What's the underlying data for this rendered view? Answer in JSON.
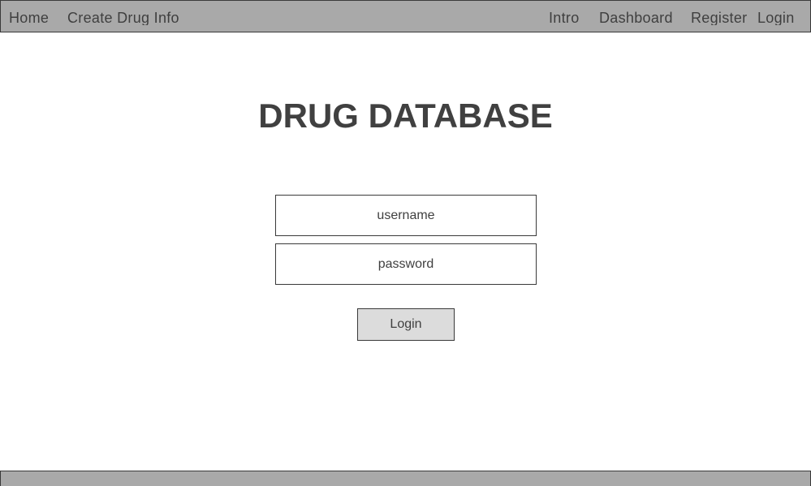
{
  "navbar": {
    "left_links": [
      {
        "label": "Home"
      },
      {
        "label": "Create Drug Info"
      }
    ],
    "right_links": [
      {
        "label": "Intro"
      },
      {
        "label": "Dashboard"
      },
      {
        "label": "Register"
      },
      {
        "label": "Login"
      }
    ]
  },
  "main": {
    "title": "DRUG DATABASE",
    "username": {
      "placeholder": "username",
      "value": ""
    },
    "password": {
      "placeholder": "password",
      "value": ""
    },
    "login_button_label": "Login"
  },
  "colors": {
    "bar_background": "#a9a9a9",
    "text": "#3f3f3f",
    "button_background": "#dcdcdc"
  }
}
